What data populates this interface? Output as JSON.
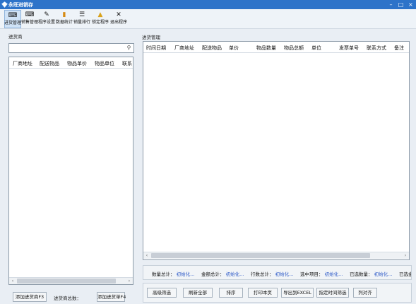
{
  "window": {
    "title": "永旺进销存",
    "minimize": "–",
    "maximize": "□",
    "close": "×"
  },
  "toolbar": {
    "items": [
      {
        "label": "进货管理",
        "icon": "purchase-icon",
        "glyph": "⌨"
      },
      {
        "label": "销售管理",
        "icon": "sales-icon",
        "glyph": "⌨"
      },
      {
        "label": "程序设置",
        "icon": "settings-icon",
        "glyph": "✎"
      },
      {
        "label": "数据统计",
        "icon": "statistics-icon",
        "glyph": "▮"
      },
      {
        "label": "销量排行",
        "icon": "ranking-icon",
        "glyph": "☰"
      },
      {
        "label": "锁定程序",
        "icon": "lock-icon",
        "glyph": "🔒"
      },
      {
        "label": "退出程序",
        "icon": "exit-icon",
        "glyph": "✕"
      }
    ]
  },
  "left_panel": {
    "title": "进货商",
    "search_icon": "⚲",
    "search_value": "",
    "columns": [
      "厂商地址",
      "配送物品",
      "物品单价",
      "物品单位",
      "联系"
    ],
    "add_supplier_button": "添加进货商F3",
    "supplier_total_label": "进货商总数：",
    "add_order_button": "添加进货单F4"
  },
  "right_panel": {
    "title": "进货管理",
    "columns": [
      "时间日期",
      "厂商地址",
      "配送物品",
      "单价",
      "物品数量",
      "物品总额",
      "单位",
      "发票单号",
      "联系方式",
      "备注"
    ]
  },
  "stats": [
    {
      "label": "数量总计：",
      "value": "初始化..."
    },
    {
      "label": "金额总计：",
      "value": "初始化..."
    },
    {
      "label": "行数总计：",
      "value": "初始化..."
    },
    {
      "label": "选中项目：",
      "value": "初始化..."
    },
    {
      "label": "已选数量：",
      "value": "初始化..."
    },
    {
      "label": "已选金",
      "value": ""
    }
  ],
  "actions": [
    "高级筛选",
    "刷新全部",
    "排序",
    "打印本页",
    "导出到EXCEL",
    "指定时间筛选",
    "列对齐"
  ],
  "scroll": {
    "left_arrow": "‹",
    "right_arrow": "›"
  },
  "colors": {
    "titlebar": "#2d73c9",
    "stat_value": "#2b58c7",
    "active_tool": "#cfe2f6"
  }
}
